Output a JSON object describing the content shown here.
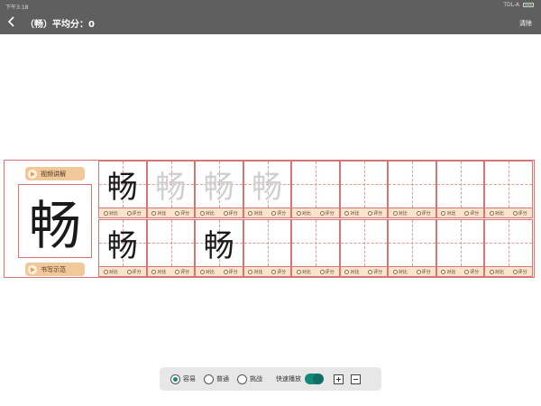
{
  "status_bar": {
    "time": "下午3:18",
    "network": "TDL-A"
  },
  "header": {
    "title": "（畅）平均分：0",
    "clear_label": "清除"
  },
  "left_panel": {
    "video_label": "视频讲解",
    "demo_label": "书写示范",
    "model_char": "畅"
  },
  "practice": {
    "compare_label": "对比",
    "score_label": "评分",
    "row1": [
      {
        "char": "畅",
        "style": "ink"
      },
      {
        "char": "畅",
        "style": "ghost"
      },
      {
        "char": "畅",
        "style": "ghost"
      },
      {
        "char": "畅",
        "style": "ghost"
      },
      {
        "char": "",
        "style": ""
      },
      {
        "char": "",
        "style": ""
      },
      {
        "char": "",
        "style": ""
      },
      {
        "char": "",
        "style": ""
      },
      {
        "char": "",
        "style": ""
      }
    ],
    "row2": [
      {
        "char": "畅",
        "style": "ink"
      },
      {
        "char": "",
        "style": ""
      },
      {
        "char": "畅",
        "style": "ink"
      },
      {
        "char": "",
        "style": ""
      },
      {
        "char": "",
        "style": ""
      },
      {
        "char": "",
        "style": ""
      },
      {
        "char": "",
        "style": ""
      },
      {
        "char": "",
        "style": ""
      },
      {
        "char": "",
        "style": ""
      }
    ]
  },
  "toolbar": {
    "modes": [
      {
        "label": "容易",
        "selected": true
      },
      {
        "label": "普通",
        "selected": false
      },
      {
        "label": "挑战",
        "selected": false
      }
    ],
    "speed_label": "快速播放",
    "speed_on": true,
    "zoom_in_icon": "plus-icon",
    "zoom_out_icon": "minus-icon"
  },
  "colors": {
    "accent": "#12897a",
    "grid": "#d87474",
    "pill": "#f1c89a",
    "header": "#5f5f5f"
  }
}
